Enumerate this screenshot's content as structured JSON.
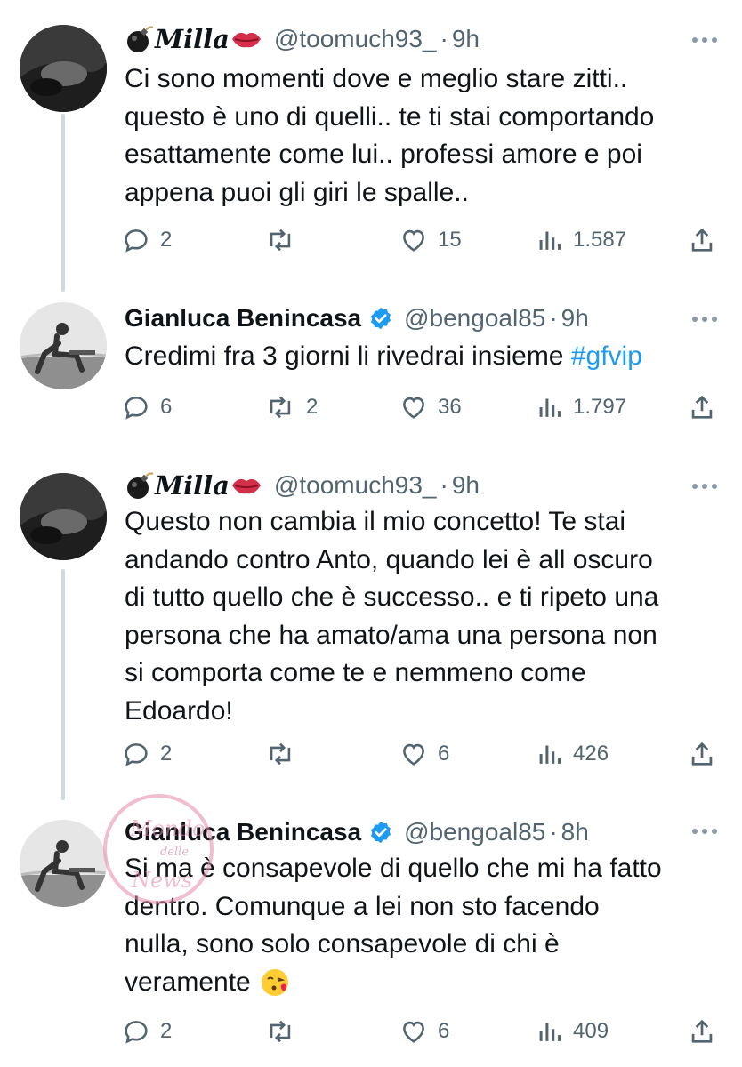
{
  "tweets": [
    {
      "id": "t1",
      "display_name": "Milla",
      "name_style": "script",
      "handle": "@toomuch93_",
      "time": "9h",
      "verified": false,
      "text_lines": [
        "Ci sono momenti dove e meglio stare zitti..",
        "questo è uno di quelli.. te ti stai comportando",
        "esattamente come lui.. professi amore e poi",
        "appena puoi gli giri le spalle.."
      ],
      "replies": "2",
      "retweets": "",
      "likes": "15",
      "views": "1.587"
    },
    {
      "id": "t2",
      "display_name": "Gianluca Benincasa",
      "name_style": "bold",
      "handle": "@bengoal85",
      "time": "9h",
      "verified": true,
      "text_prefix": "Credimi fra 3 giorni li rivedrai insieme ",
      "hashtag": "#gfvip",
      "replies": "6",
      "retweets": "2",
      "likes": "36",
      "views": "1.797"
    },
    {
      "id": "t3",
      "display_name": "Milla",
      "name_style": "script",
      "handle": "@toomuch93_",
      "time": "9h",
      "verified": false,
      "text_lines": [
        "Questo non cambia il mio concetto! Te stai",
        "andando contro Anto, quando lei è all oscuro",
        "di tutto quello che è successo.. e ti ripeto una",
        "persona che ha amato/ama una persona non",
        "si comporta come te e nemmeno come",
        "Edoardo!"
      ],
      "replies": "2",
      "retweets": "",
      "likes": "6",
      "views": "426"
    },
    {
      "id": "t4",
      "display_name": "Gianluca Benincasa",
      "name_style": "bold",
      "handle": "@bengoal85",
      "time": "8h",
      "verified": true,
      "text_lines": [
        "Si ma è consapevole di quello che mi ha fatto",
        "dentro. Comunque a lei non sto facendo",
        "nulla, sono solo consapevole di chi è",
        "veramente"
      ],
      "emoji": "face-blowing-kiss",
      "replies": "2",
      "retweets": "",
      "likes": "6",
      "views": "409"
    }
  ],
  "separator": "·",
  "colors": {
    "text": "#0f1419",
    "secondary": "#536471",
    "link": "#1d9bf0",
    "verified": "#1d9bf0",
    "thread_line": "#cfd9de"
  },
  "watermark": {
    "line1": "Mondo",
    "line2": "delle",
    "line3": "News",
    "banner": "le reines del web"
  }
}
